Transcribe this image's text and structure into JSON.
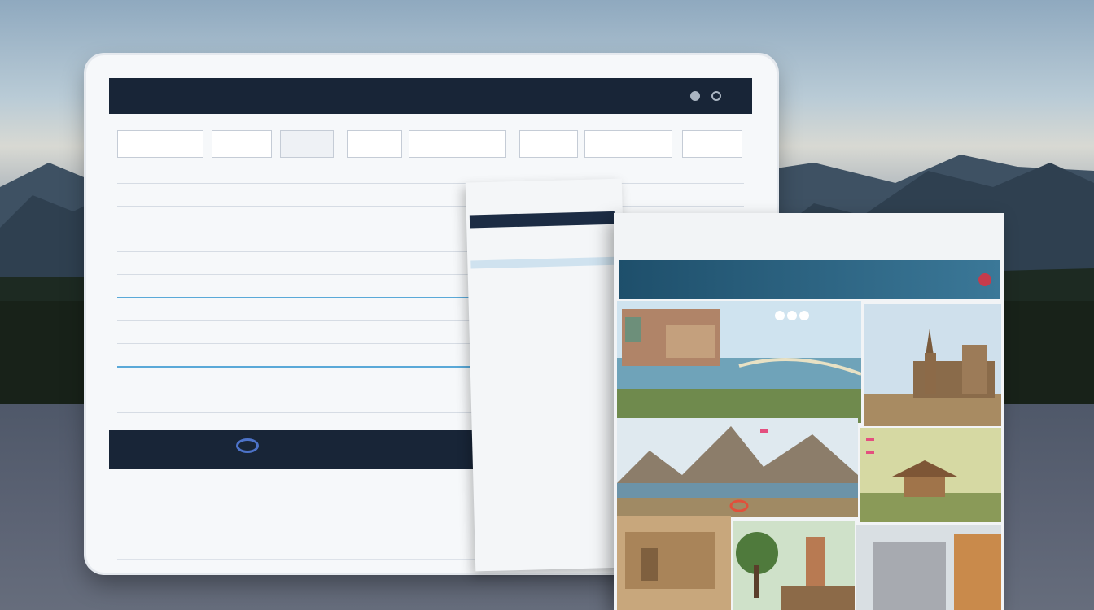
{
  "tablet": {
    "top_caption": "",
    "header_title": "",
    "header_title_2": "",
    "header_right_1": "",
    "header_right_2": ""
  },
  "filters": [],
  "grid_rows": [],
  "promo": {
    "logo": "",
    "sub": "",
    "right": "",
    "right_sub": ""
  },
  "lower_rows": [],
  "doc_mid": {
    "head": "",
    "bar": ""
  },
  "brochure": {
    "banner": ""
  },
  "colors": {
    "header_navy": "#182537",
    "highlight_blue": "#5aa9d8",
    "banner_teal": "#1e4f6b",
    "tag_pink": "#e44f7f"
  }
}
